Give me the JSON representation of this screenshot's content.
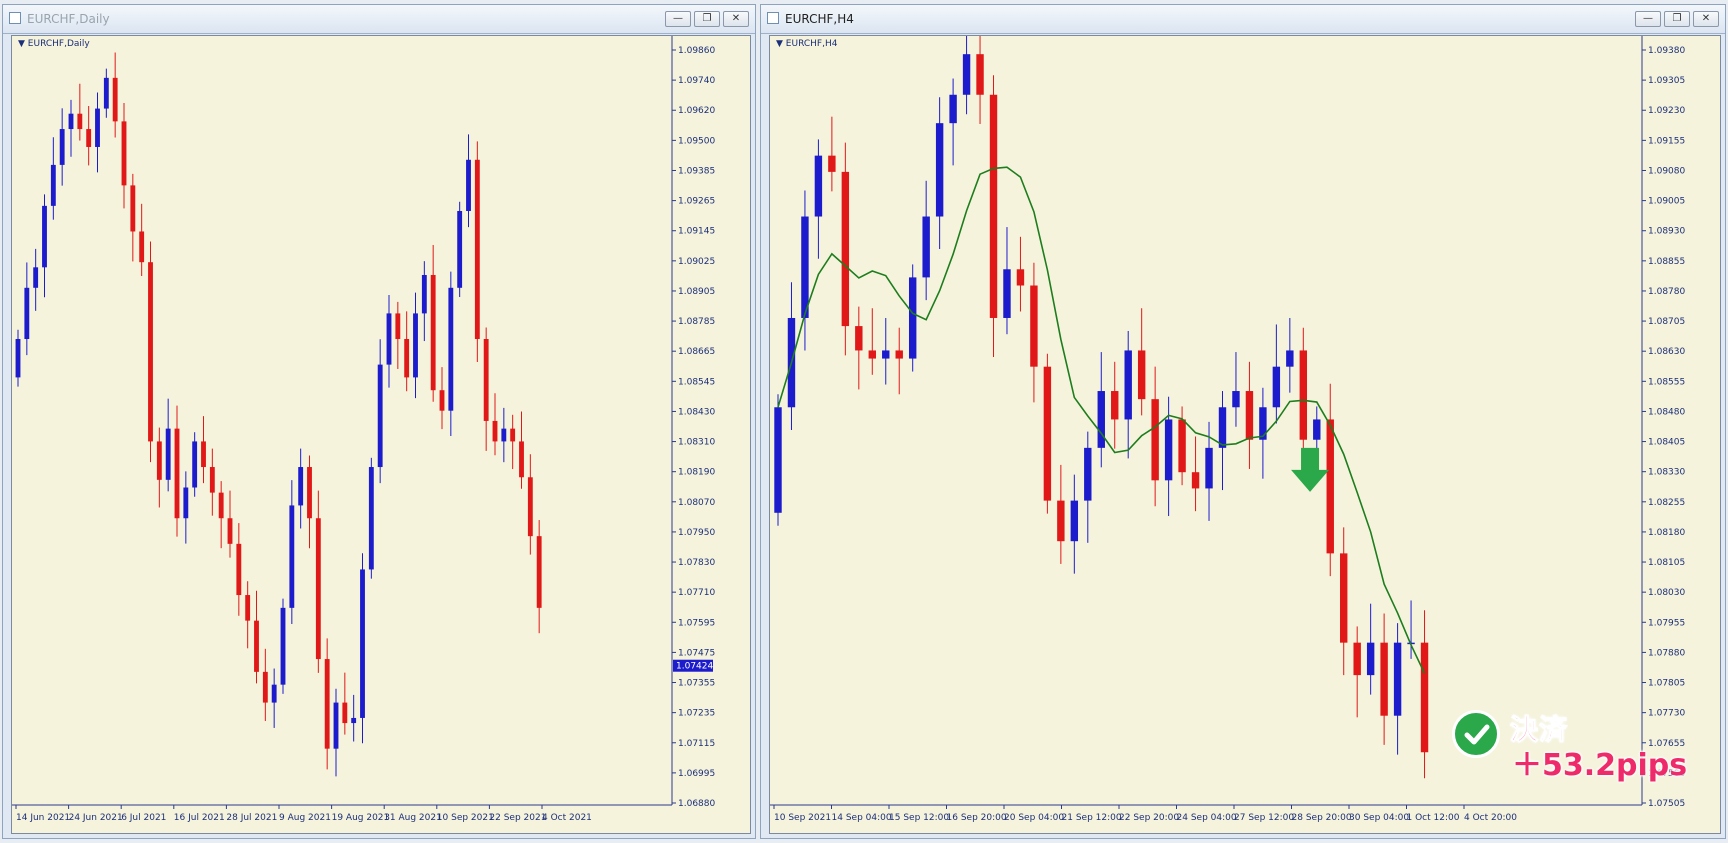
{
  "windows": [
    {
      "title": "EURCHF,Daily",
      "symbol_label": "EURCHF,Daily",
      "buttons": [
        "minimize",
        "restore",
        "close"
      ]
    },
    {
      "title": "EURCHF,H4",
      "symbol_label": "EURCHF,H4",
      "buttons": [
        "minimize",
        "restore",
        "close"
      ]
    }
  ],
  "charts": {
    "left": {
      "price_min": 1.0688,
      "price_max": 1.0986,
      "price_labels": [
        "1.09860",
        "1.09740",
        "1.09620",
        "1.09500",
        "1.09385",
        "1.09265",
        "1.09145",
        "1.09025",
        "1.08905",
        "1.08785",
        "1.08665",
        "1.08545",
        "1.08430",
        "1.08310",
        "1.08190",
        "1.08070",
        "1.07950",
        "1.07830",
        "1.07710",
        "1.07595",
        "1.07475",
        "1.07355",
        "1.07235",
        "1.07115",
        "1.06995",
        "1.06880"
      ],
      "current_price": "1.07424",
      "date_labels": [
        "14 Jun 2021",
        "24 Jun 2021",
        "6 Jul 2021",
        "16 Jul 2021",
        "28 Jul 2021",
        "9 Aug 2021",
        "19 Aug 2021",
        "31 Aug 2021",
        "10 Sep 2021",
        "22 Sep 2021",
        "4 Oct 2021"
      ],
      "candle_up_color": "#1c1ccd",
      "candle_down_color": "#e01818"
    },
    "right": {
      "price_min": 1.075,
      "price_max": 1.0938,
      "price_labels": [
        "1.09380",
        "1.09305",
        "1.09230",
        "1.09155",
        "1.09080",
        "1.09005",
        "1.08930",
        "1.08855",
        "1.08780",
        "1.08705",
        "1.08630",
        "1.08555",
        "1.08480",
        "1.08405",
        "1.08330",
        "1.08255",
        "1.08180",
        "1.08105",
        "1.08030",
        "1.07955",
        "1.07880",
        "1.07805",
        "1.07730",
        "1.07655",
        "1.07580",
        "1.07505"
      ],
      "date_labels": [
        "10 Sep 2021",
        "14 Sep 04:00",
        "15 Sep 12:00",
        "16 Sep 20:00",
        "20 Sep 04:00",
        "21 Sep 12:00",
        "22 Sep 20:00",
        "24 Sep 04:00",
        "27 Sep 12:00",
        "28 Sep 20:00",
        "30 Sep 04:00",
        "1 Oct 12:00",
        "4 Oct 20:00"
      ],
      "ma_color": "#1e7d1e",
      "arrow_color": "#2aa84a"
    }
  },
  "overlay": {
    "stamp_line1": "決済",
    "stamp_line2": "＋53.2pips"
  },
  "chart_data": [
    {
      "type": "candlestick",
      "title": "EURCHF,Daily",
      "ylim": [
        1.0688,
        1.0986
      ],
      "series": [
        {
          "name": "EURCHF,Daily",
          "values": [
            1.087,
            1.089,
            1.0898,
            1.0922,
            1.0938,
            1.0952,
            1.0958,
            1.0952,
            1.0945,
            1.096,
            1.0972,
            1.0955,
            1.093,
            1.0912,
            1.09,
            1.083,
            1.0815,
            1.0835,
            1.08,
            1.0812,
            1.083,
            1.082,
            1.081,
            1.08,
            1.079,
            1.077,
            1.076,
            1.074,
            1.0728,
            1.0735,
            1.0765,
            1.0805,
            1.082,
            1.08,
            1.0745,
            1.071,
            1.0728,
            1.072,
            1.0722,
            1.078,
            1.082,
            1.086,
            1.088,
            1.087,
            1.0855,
            1.088,
            1.0895,
            1.085,
            1.0842,
            1.089,
            1.092,
            1.094,
            1.087,
            1.0838,
            1.083,
            1.0835,
            1.083,
            1.0816,
            1.0793,
            1.0765
          ]
        }
      ],
      "current_value": 1.07424
    },
    {
      "type": "candlestick",
      "title": "EURCHF,H4",
      "ylim": [
        1.075,
        1.0938
      ],
      "series": [
        {
          "name": "EURCHF,H4",
          "values": [
            1.0848,
            1.087,
            1.0895,
            1.091,
            1.0906,
            1.0868,
            1.0862,
            1.086,
            1.0862,
            1.086,
            1.088,
            1.0895,
            1.0918,
            1.0925,
            1.0935,
            1.0925,
            1.087,
            1.0882,
            1.0878,
            1.0858,
            1.0825,
            1.0815,
            1.0825,
            1.0838,
            1.0852,
            1.0845,
            1.0862,
            1.085,
            1.083,
            1.0845,
            1.0832,
            1.0828,
            1.0838,
            1.0848,
            1.0852,
            1.084,
            1.0848,
            1.0858,
            1.0862,
            1.084,
            1.0845,
            1.0812,
            1.079,
            1.0782,
            1.079,
            1.0772,
            1.079,
            1.079,
            1.0763
          ]
        }
      ]
    }
  ]
}
